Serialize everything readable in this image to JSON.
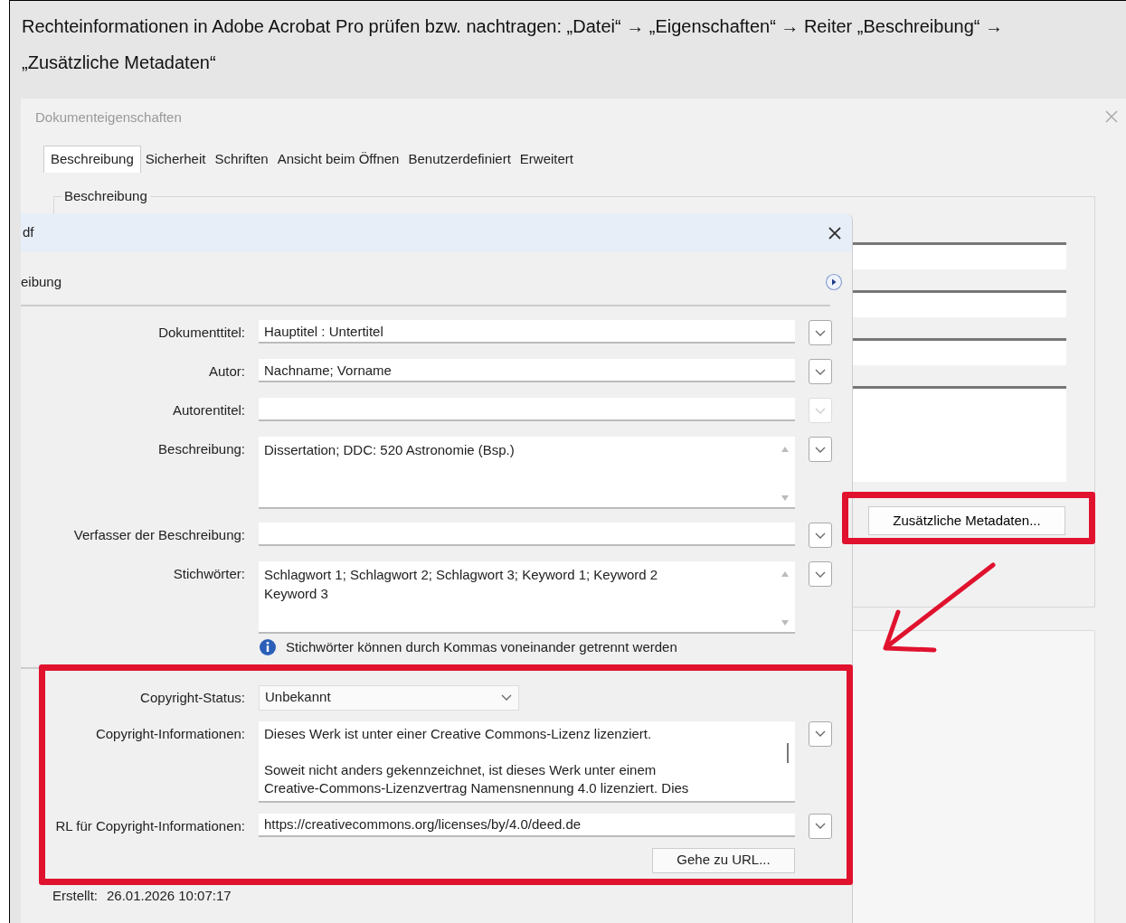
{
  "caption": "Rechteinformationen in Adobe Acrobat Pro prüfen bzw. nachtragen: „Datei“ → „Eigenschaften“ → Reiter „Beschreibung“ → „Zusätzliche Metadaten“",
  "back_dialog": {
    "title": "Dokumenteigenschaften",
    "tabs": [
      {
        "label": "Beschreibung",
        "selected": true
      },
      {
        "label": "Sicherheit",
        "selected": false
      },
      {
        "label": "Schriften",
        "selected": false
      },
      {
        "label": "Ansicht beim Öffnen",
        "selected": false
      },
      {
        "label": "Benutzerdefiniert",
        "selected": false
      },
      {
        "label": "Erweitert",
        "selected": false
      }
    ],
    "group_label": "Beschreibung",
    "metadata_button": "Zusätzliche Metadaten..."
  },
  "front_dialog": {
    "title": "df",
    "section": "eibung",
    "fields": [
      {
        "label": "Dokumenttitel:",
        "kind": "text",
        "value": "Hauptitel : Untertitel",
        "menu_disabled": false
      },
      {
        "label": "Autor:",
        "kind": "text",
        "value": "Nachname; Vorname",
        "menu_disabled": false
      },
      {
        "label": "Autorentitel:",
        "kind": "text",
        "menu_disabled": true
      },
      {
        "label": "Beschreibung:",
        "kind": "textarea",
        "value": "Dissertation; DDC: 520 Astronomie (Bsp.)",
        "menu_disabled": false
      },
      {
        "label": "Verfasser der Beschreibung:",
        "kind": "text",
        "menu_disabled": false
      },
      {
        "label": "Stichwörter:",
        "kind": "textarea",
        "value": "Schlagwort 1; Schlagwort 2; Schlagwort 3; Keyword 1; Keyword 2\nKeyword 3",
        "menu_disabled": false
      }
    ],
    "hint": "Stichwörter können durch Kommas voneinander getrennt werden",
    "copyright_fields": [
      {
        "label": "Copyright-Status:",
        "kind": "select",
        "value": "Unbekannt"
      },
      {
        "label": "Copyright-Informationen:",
        "kind": "info",
        "value": "Dieses Werk ist unter einer Creative Commons-Lizenz lizenziert.\n\nSoweit nicht anders gekennzeichnet, ist dieses Werk unter einem\nCreative-Commons-Lizenzvertrag Namensnennung 4.0 lizenziert. Dies",
        "menu_disabled": false
      },
      {
        "label": "RL für Copyright-Informationen:",
        "kind": "text",
        "value": "https://creativecommons.org/licenses/by/4.0/deed.de",
        "menu_disabled": false
      }
    ],
    "go_button": "Gehe zu URL...",
    "created_label": "Erstellt:",
    "created_value": "26.01.2026 10:07:17"
  }
}
